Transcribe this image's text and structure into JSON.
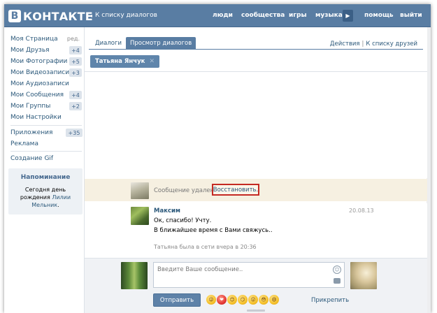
{
  "header": {
    "logo_letter": "В",
    "logo_text": "КОНТАКТЕ",
    "back_arrow": "◂",
    "back_link": "К списку диалогов",
    "nav": [
      "люди",
      "сообщества",
      "игры",
      "музыка",
      "помощь",
      "выйти"
    ],
    "play_glyph": "▶"
  },
  "sidebar": {
    "my_page": "Моя Страница",
    "edit": "ред.",
    "items": [
      {
        "label": "Мои Друзья",
        "badge": "+4"
      },
      {
        "label": "Мои Фотографии",
        "badge": "+5"
      },
      {
        "label": "Мои Видеозаписи",
        "badge": "+3"
      },
      {
        "label": "Мои Аудиозаписи",
        "badge": ""
      },
      {
        "label": "Мои Сообщения",
        "badge": "+4"
      },
      {
        "label": "Мои Группы",
        "badge": "+2"
      },
      {
        "label": "Мои Настройки",
        "badge": ""
      }
    ],
    "apps": {
      "label": "Приложения",
      "badge": "+35"
    },
    "ads": "Реклама",
    "create_gif": "Создание Gif",
    "reminder": {
      "title": "Напоминание",
      "text_part1": "Сегодня ",
      "text_part2": "день рождения",
      "text_part3": " ",
      "name_link": "Лилии Мельник",
      "text_end": "."
    }
  },
  "main": {
    "tab_dialogs": "Диалоги",
    "tab_view": "Просмотр диалогов",
    "action_1": "Действия",
    "action_sep": "|",
    "action_2": "К списку друзей",
    "chip_name": "Татьяна Янчук",
    "chip_close": "✕",
    "deleted_text": "Сообщение удалено.",
    "restore_label": "Восстановить.",
    "message": {
      "author": "Максим",
      "date": "20.08.13",
      "line1": "Ок, спасибо! Учту.",
      "line2": "В ближайшее время с Вами свяжусь.."
    },
    "status": "Татьяна была в сети вчера в 20:36",
    "composer": {
      "placeholder": "Введите Ваше сообщение..",
      "send_label": "Отправить",
      "attach_label": "Прикрепить",
      "smile_glyph": "☺",
      "emojis": [
        "😜",
        "❤",
        "😊",
        "😏",
        "😲",
        "😳",
        "😄"
      ]
    }
  },
  "colors": {
    "header_blue": "#597da3",
    "link_blue": "#2b587a",
    "restore_outline": "#c42a23",
    "deleted_bg": "#f6f0e1"
  }
}
